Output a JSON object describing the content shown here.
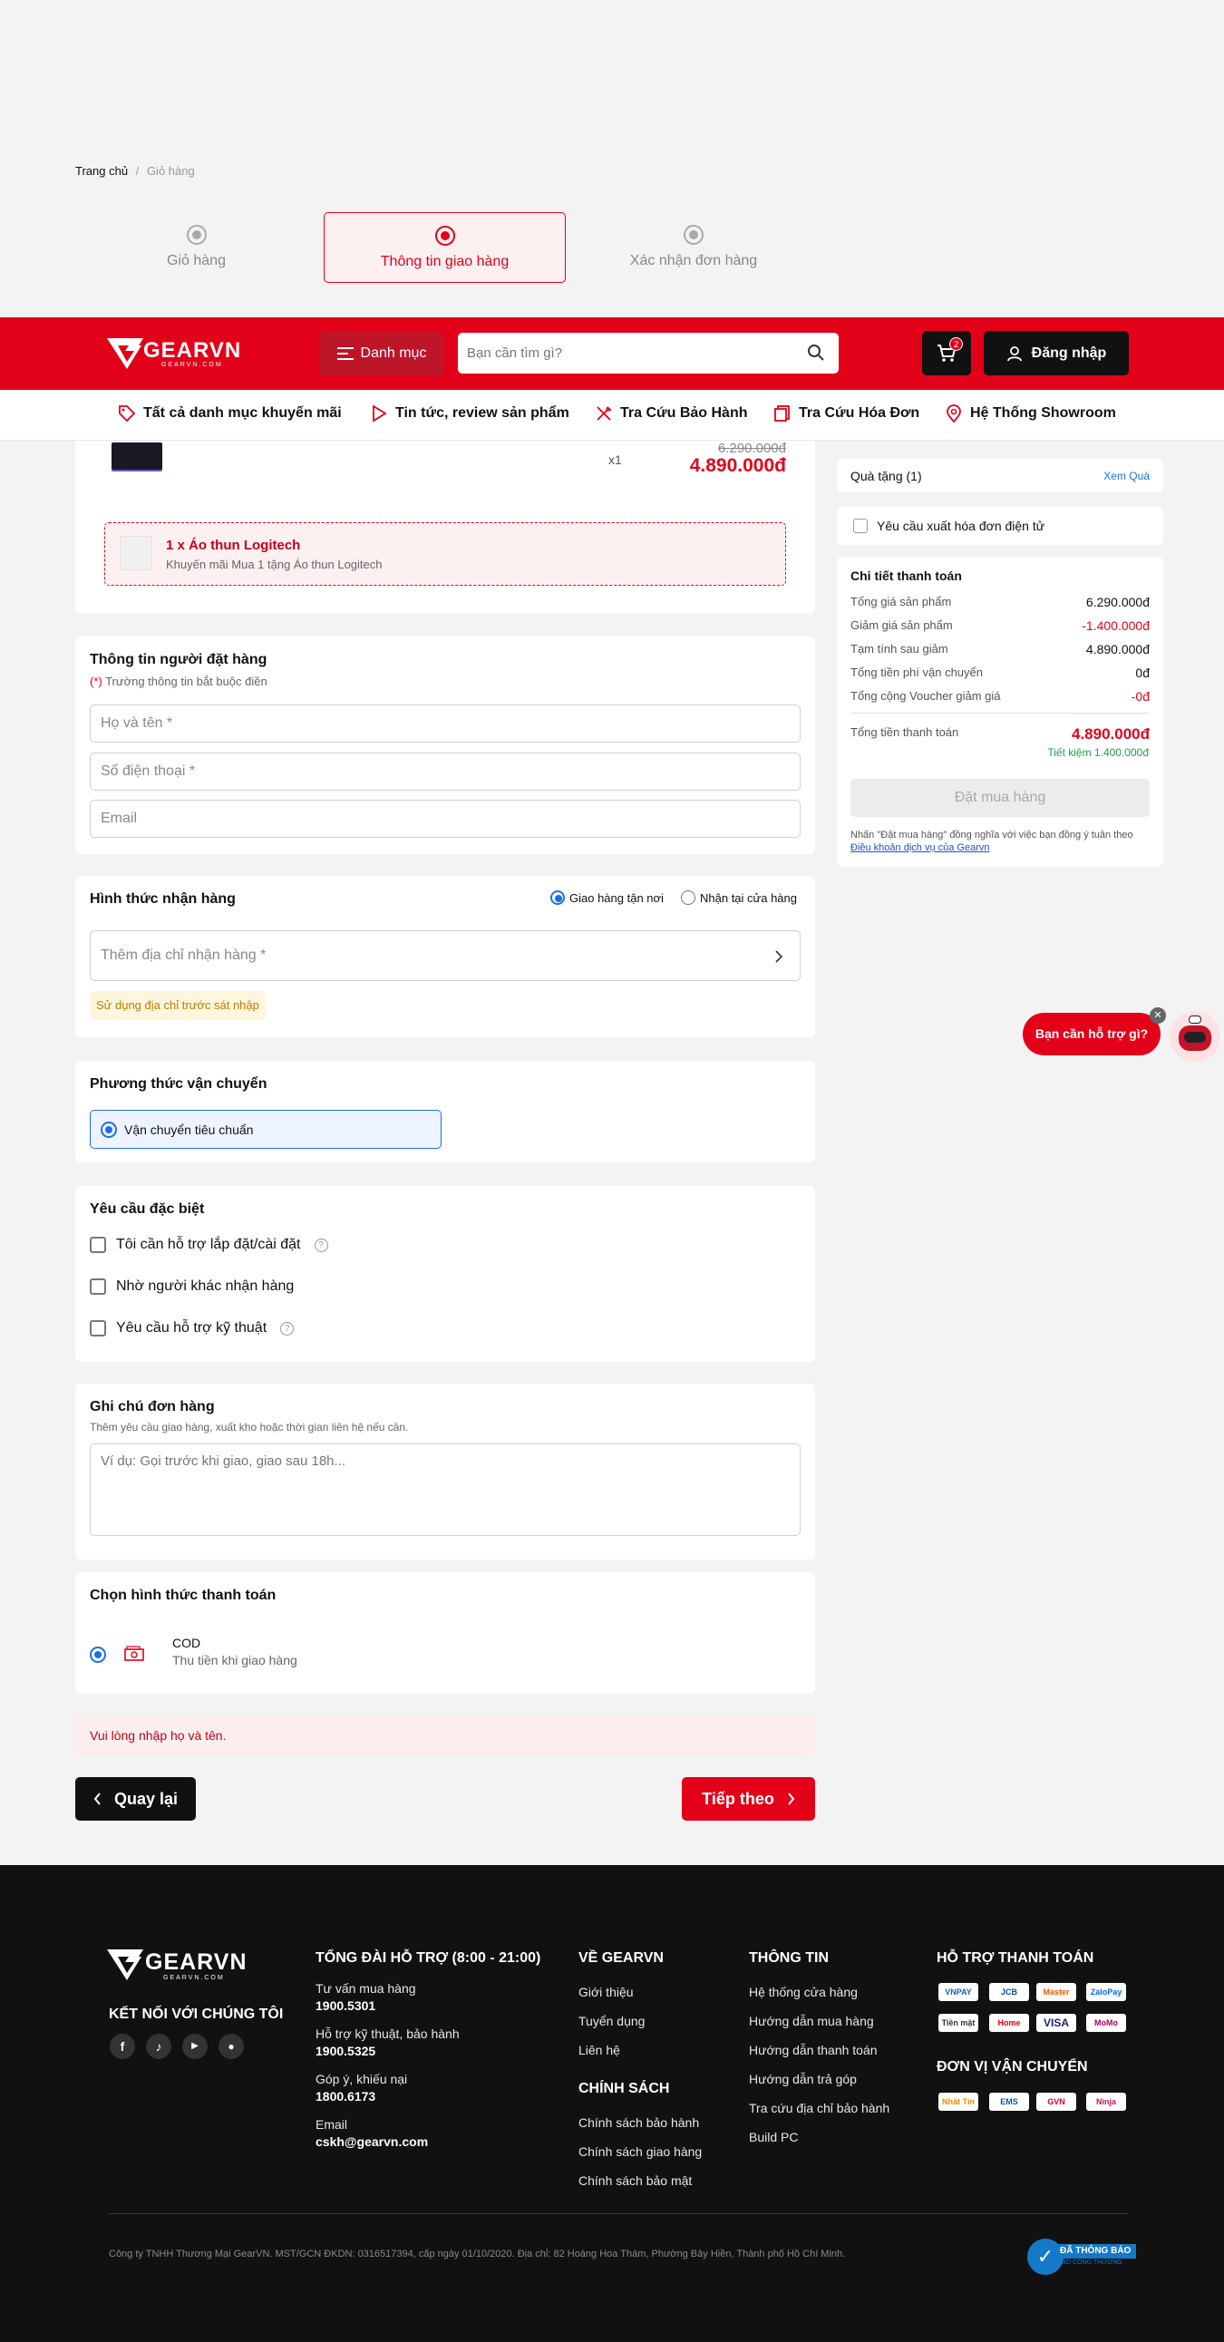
{
  "breadcrumb": {
    "home": "Trang chủ",
    "separator": "/",
    "current": "Giỏ hàng"
  },
  "steps": [
    {
      "label": "Giỏ hàng",
      "active": false
    },
    {
      "label": "Thông tin giao hàng",
      "active": true
    },
    {
      "label": "Xác nhận đơn hàng",
      "active": false
    }
  ],
  "header": {
    "logo_text": "GEARVN",
    "logo_sub": "GEARVN.COM",
    "menu_label": "Danh mục",
    "search_placeholder": "Bạn cần tìm gì?",
    "cart_count": "2",
    "login_label": "Đăng nhập"
  },
  "nav": [
    {
      "label": "Tất cả danh mục khuyến mãi",
      "icon": "tag-icon"
    },
    {
      "label": "Tin tức, review sản phẩm",
      "icon": "play-icon"
    },
    {
      "label": "Tra Cứu Bảo Hành",
      "icon": "tools-icon"
    },
    {
      "label": "Tra Cứu Hóa Đơn",
      "icon": "invoice-icon"
    },
    {
      "label": "Hệ Thống Showroom",
      "icon": "location-icon"
    }
  ],
  "product": {
    "quantity": "x1",
    "old_price": "6.290.000đ",
    "price": "4.890.000đ",
    "gift_title": "1 x Áo thun Logitech",
    "gift_desc": "Khuyến mãi Mua 1 tặng Áo thun Logitech"
  },
  "orderer": {
    "title": "Thông tin người đặt hàng",
    "required_mark": "(*)",
    "required_note": " Trường thông tin bắt buộc điền",
    "name_placeholder": "Họ và tên *",
    "phone_placeholder": "Số điện thoại *",
    "email_placeholder": "Email"
  },
  "delivery": {
    "title": "Hình thức nhận hàng",
    "option_home": "Giao hàng tận nơi",
    "option_store": "Nhận tại cửa hàng",
    "address_placeholder": "Thêm địa chỉ nhận hàng *",
    "prev_address": "Sử dụng địa chỉ trước sát nhập"
  },
  "shipping": {
    "title": "Phương thức vận chuyển",
    "option": "Vận chuyển tiêu chuẩn"
  },
  "special": {
    "title": "Yêu cầu đặc biệt",
    "options": [
      "Tôi cần hỗ trợ lắp đặt/cài đặt",
      "Nhờ người khác nhận hàng",
      "Yêu cầu hỗ trợ kỹ thuật"
    ]
  },
  "note": {
    "title": "Ghi chú đơn hàng",
    "desc": "Thêm yêu cầu giao hàng, xuất kho hoặc thời gian liên hệ nếu cần.",
    "placeholder": "Ví dụ: Gọi trước khi giao, giao sau 18h..."
  },
  "payment": {
    "title": "Chọn hình thức thanh toán",
    "method": "COD",
    "method_desc": "Thu tiền khi giao hàng"
  },
  "error": "Vui lòng nhập họ và tên.",
  "buttons": {
    "back": "Quay lại",
    "next": "Tiếp theo"
  },
  "sidebar": {
    "gift_label": "Quà tặng (1)",
    "gift_link": "Xem Quà",
    "invoice_label": "Yêu cầu xuất hóa đơn điện tử",
    "summary_title": "Chi tiết thanh toán",
    "rows": [
      {
        "label": "Tổng giá sản phẩm",
        "value": "6.290.000đ",
        "red": false
      },
      {
        "label": "Giảm giá sản phẩm",
        "value": "-1.400.000đ",
        "red": true
      },
      {
        "label": "Tạm tính sau giảm",
        "value": "4.890.000đ",
        "red": false
      },
      {
        "label": "Tổng tiền phí vận chuyển",
        "value": "0đ",
        "red": false
      },
      {
        "label": "Tổng cộng Voucher giảm giá",
        "value": "-0đ",
        "red": true
      }
    ],
    "total_label": "Tổng tiền thanh toán",
    "total_value": "4.890.000đ",
    "saving": "Tiết kiệm 1.400.000đ",
    "order_button": "Đặt mua hàng",
    "terms_prefix": "Nhấn \"Đặt mua hàng\" đồng nghĩa với việc bạn đồng ý tuân theo ",
    "terms_link": "Điều khoản dịch vụ của Gearvn"
  },
  "chat": {
    "label": "Bạn cần hỗ trợ gì?"
  },
  "footer": {
    "connect_title": "KẾT NỐI VỚI CHÚNG TÔI",
    "support_title": "TỔNG ĐÀI HỖ TRỢ (8:00 - 21:00)",
    "support": [
      {
        "label": "Tư vấn mua hàng",
        "value": "1900.5301"
      },
      {
        "label": "Hỗ trợ kỹ thuật, bảo hành",
        "value": "1900.5325"
      },
      {
        "label": "Góp ý, khiếu nại",
        "value": "1800.6173"
      },
      {
        "label": "Email",
        "value": "cskh@gearvn.com"
      }
    ],
    "about_title": "VỀ GEARVN",
    "about": [
      "Giới thiệu",
      "Tuyển dụng",
      "Liên hệ"
    ],
    "policy_title": "CHÍNH SÁCH",
    "policy": [
      "Chính sách bảo hành",
      "Chính sách giao hàng",
      "Chính sách bảo mật"
    ],
    "info_title": "THÔNG TIN",
    "info": [
      "Hệ thống cửa hàng",
      "Hướng dẫn mua hàng",
      "Hướng dẫn thanh toán",
      "Hướng dẫn trả góp",
      "Tra cứu địa chỉ bảo hành",
      "Build PC"
    ],
    "payment_title": "HỖ TRỢ THANH TOÁN",
    "payment_badges": [
      "VNPAY",
      "JCB",
      "Master",
      "ZaloPay",
      "Tiền mặt",
      "Home",
      "VISA",
      "MoMo"
    ],
    "shipping_title": "ĐƠN VỊ VẬN CHUYỂN",
    "shipping_badges": [
      "Nhất Tín",
      "EMS",
      "GVN",
      "Ninja"
    ],
    "company": "Công ty TNHH Thương Mại GearVN. MST/GCN ĐKDN: 0316517394, cấp ngày 01/10/2020. Địa chỉ: 82 Hoàng Hoa Thám, Phường Bảy Hiền, Thành phố Hồ Chí Minh.",
    "cert": "ĐÃ THÔNG BÁO",
    "cert_sub": "BỘ CÔNG THƯƠNG"
  }
}
